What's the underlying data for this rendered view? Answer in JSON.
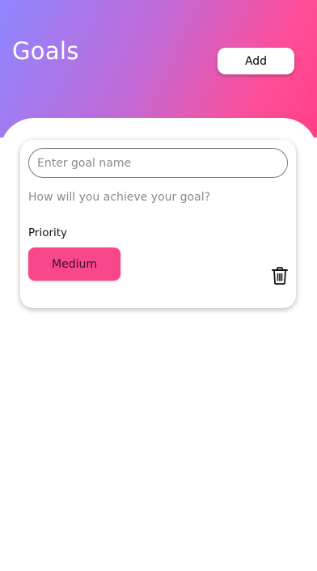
{
  "header": {
    "title": "Goals",
    "add_label": "Add",
    "gradient_colors": [
      "#8f86ff",
      "#c169d6",
      "#ff4e98"
    ]
  },
  "goal_card": {
    "name_placeholder": "Enter goal name",
    "name_value": "",
    "how_placeholder": "How will you achieve your goal?",
    "how_value": "",
    "priority_label": "Priority",
    "priority_value": "Medium",
    "priority_color": "#f8488b",
    "delete_icon": "trash-icon"
  }
}
